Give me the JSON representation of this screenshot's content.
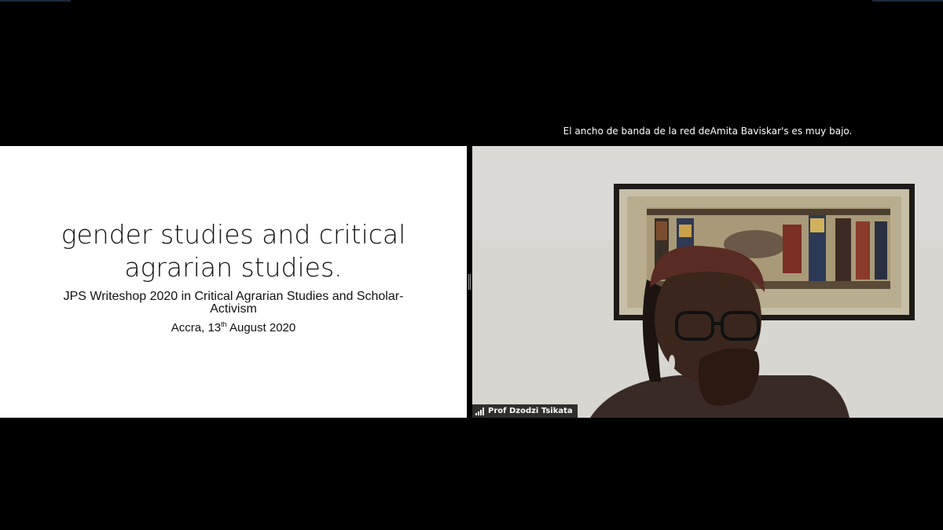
{
  "shared_slide": {
    "title_line1": "gender studies and critical",
    "title_line2": "agrarian studies.",
    "subtitle_line1": "JPS Writeshop 2020 in Critical Agrarian Studies and Scholar-",
    "subtitle_line2": "Activism",
    "date_prefix": "Accra, 13",
    "date_superscript": "th",
    "date_suffix": " August 2020"
  },
  "network_notice": "El ancho de banda de la red deAmita Baviskar's es muy bajo.",
  "participant": {
    "name": "Prof Dzodzi Tsikata",
    "signal_icon": "signal-strength-icon"
  },
  "colors": {
    "background": "#000000",
    "slide_background": "#ffffff",
    "wall": "#d9d7d2",
    "name_tag_background": "#000000"
  }
}
